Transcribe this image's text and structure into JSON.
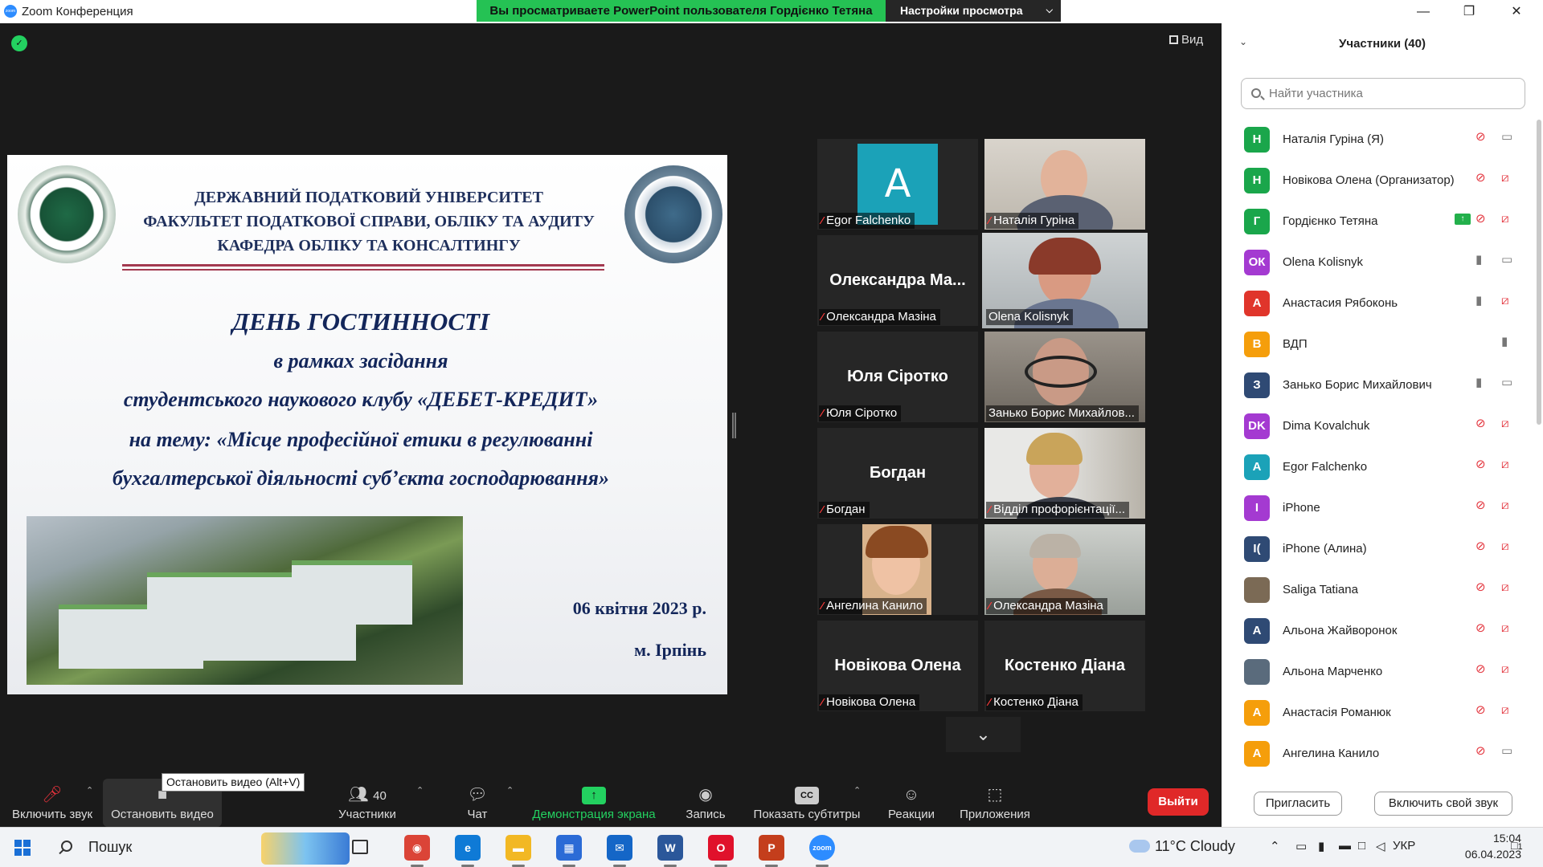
{
  "window": {
    "title": "Zoom Конференция",
    "share_banner": "Вы просматриваете PowerPoint пользователя Гордієнко Тетяна",
    "view_settings": "Настройки просмотра",
    "view_button": "Вид"
  },
  "slide": {
    "university": "ДЕРЖАВНИЙ ПОДАТКОВИЙ УНІВЕРСИТЕТ",
    "faculty": "ФАКУЛЬТЕТ ПОДАТКОВОЇ СПРАВИ, ОБЛІКУ ТА АУДИТУ",
    "department": "КАФЕДРА ОБЛІКУ ТА КОНСАЛТИНГУ",
    "event_title": "ДЕНЬ ГОСТИННОСТІ",
    "line1": "в рамках засідання",
    "line2": "студентського наукового клубу «ДЕБЕТ-КРЕДИТ»",
    "line3": "на тему: «Місце професійної етики в регулюванні",
    "line4": "бухгалтерської діяльності суб’єкта господарювання»",
    "date": "06 квітня 2023 р.",
    "city": "м. Ірпінь"
  },
  "tiles": [
    {
      "label": "Egor Falchenko",
      "avatar_letter": "A",
      "big_name": ""
    },
    {
      "label": "Наталія Гуріна",
      "big_name": ""
    },
    {
      "label": "Олександра Мазіна",
      "big_name": "Олександра Ма..."
    },
    {
      "label": "Olena Kolisnyk",
      "big_name": ""
    },
    {
      "label": "Юля Сіротко",
      "big_name": "Юля Сіротко"
    },
    {
      "label": "Занько Борис Михайлов...",
      "big_name": ""
    },
    {
      "label": "Богдан",
      "big_name": "Богдан"
    },
    {
      "label": "Відділ профорієнтації...",
      "big_name": ""
    },
    {
      "label": "Ангелина Канило",
      "big_name": ""
    },
    {
      "label": "Олександра Мазіна",
      "big_name": ""
    },
    {
      "label": "Новікова Олена",
      "big_name": "Новікова Олена"
    },
    {
      "label": "Костенко Діана",
      "big_name": "Костенко Діана"
    }
  ],
  "toolbar": {
    "unmute": "Включить звук",
    "stop_video": "Остановить видео",
    "video_tooltip": "Остановить видео (Alt+V)",
    "participants": "Участники",
    "participants_count": "40",
    "chat": "Чат",
    "share_screen": "Демонстрация экрана",
    "record": "Запись",
    "captions": "Показать субтитры",
    "captions_icon": "CC",
    "reactions": "Реакции",
    "apps": "Приложения",
    "leave": "Выйти"
  },
  "panel": {
    "title": "Участники (40)",
    "search_placeholder": "Найти участника",
    "invite": "Пригласить",
    "unmute_me": "Включить свой звук",
    "participants": [
      {
        "initials": "Н",
        "name": "Наталія Гуріна (Я)",
        "color": "#1aa64b",
        "mic": "muted",
        "cam": "on"
      },
      {
        "initials": "Н",
        "name": "Новікова Олена (Организатор)",
        "color": "#1aa64b",
        "mic": "muted",
        "cam": "off"
      },
      {
        "initials": "Г",
        "name": "Гордієнко Тетяна",
        "color": "#1aa64b",
        "mic": "muted",
        "cam": "off",
        "sharing": true
      },
      {
        "initials": "ОК",
        "name": "Olena Kolisnyk",
        "color": "#a43ad1",
        "mic": "on",
        "cam": "on"
      },
      {
        "initials": "А",
        "name": "Анастасия Рябоконь",
        "color": "#e0352b",
        "mic": "on",
        "cam": "off"
      },
      {
        "initials": "В",
        "name": "ВДП",
        "color": "#f59e0b",
        "mic": "on",
        "cam": "none"
      },
      {
        "initials": "З",
        "name": "Занько Борис Михайлович",
        "color": "#2f4a74",
        "mic": "on",
        "cam": "on"
      },
      {
        "initials": "DK",
        "name": "Dima Kovalchuk",
        "color": "#a43ad1",
        "mic": "muted",
        "cam": "off"
      },
      {
        "initials": "A",
        "name": "Egor Falchenko",
        "color": "#1ba2b8",
        "mic": "muted",
        "cam": "off"
      },
      {
        "initials": "I",
        "name": "iPhone",
        "color": "#a43ad1",
        "mic": "muted",
        "cam": "off"
      },
      {
        "initials": "I(",
        "name": "iPhone (Алина)",
        "color": "#2f4a74",
        "mic": "muted",
        "cam": "off"
      },
      {
        "initials": "",
        "name": "Saliga Tatiana",
        "color": "#7b6a55",
        "mic": "muted",
        "cam": "off"
      },
      {
        "initials": "А",
        "name": "Альона Жайворонок",
        "color": "#2f4a74",
        "mic": "muted",
        "cam": "off"
      },
      {
        "initials": "",
        "name": "Альона Марченко",
        "color": "#5a6b7c",
        "mic": "muted",
        "cam": "off"
      },
      {
        "initials": "А",
        "name": "Анастасія Романюк",
        "color": "#f59e0b",
        "mic": "muted",
        "cam": "off"
      },
      {
        "initials": "А",
        "name": "Ангелина Канило",
        "color": "#f59e0b",
        "mic": "muted",
        "cam": "on"
      }
    ]
  },
  "taskbar": {
    "search": "Пошук",
    "weather": "11°C  Cloudy",
    "lang": "УКР",
    "time": "15:04",
    "date": "06.04.2023",
    "notifications": "1",
    "apps": [
      {
        "name": "chrome",
        "glyph": "◉",
        "color": "#db4437"
      },
      {
        "name": "edge",
        "glyph": "e",
        "color": "#0f7ad6"
      },
      {
        "name": "explorer",
        "glyph": "▬",
        "color": "#f2b824"
      },
      {
        "name": "store",
        "glyph": "▦",
        "color": "#2b6bd6"
      },
      {
        "name": "mail",
        "glyph": "✉",
        "color": "#1466c7"
      },
      {
        "name": "word",
        "glyph": "W",
        "color": "#2b579a"
      },
      {
        "name": "opera",
        "glyph": "O",
        "color": "#e0112b"
      },
      {
        "name": "powerpoint",
        "glyph": "P",
        "color": "#c43e1c"
      },
      {
        "name": "zoom",
        "glyph": "zoom",
        "color": "#2d8cff"
      }
    ]
  }
}
